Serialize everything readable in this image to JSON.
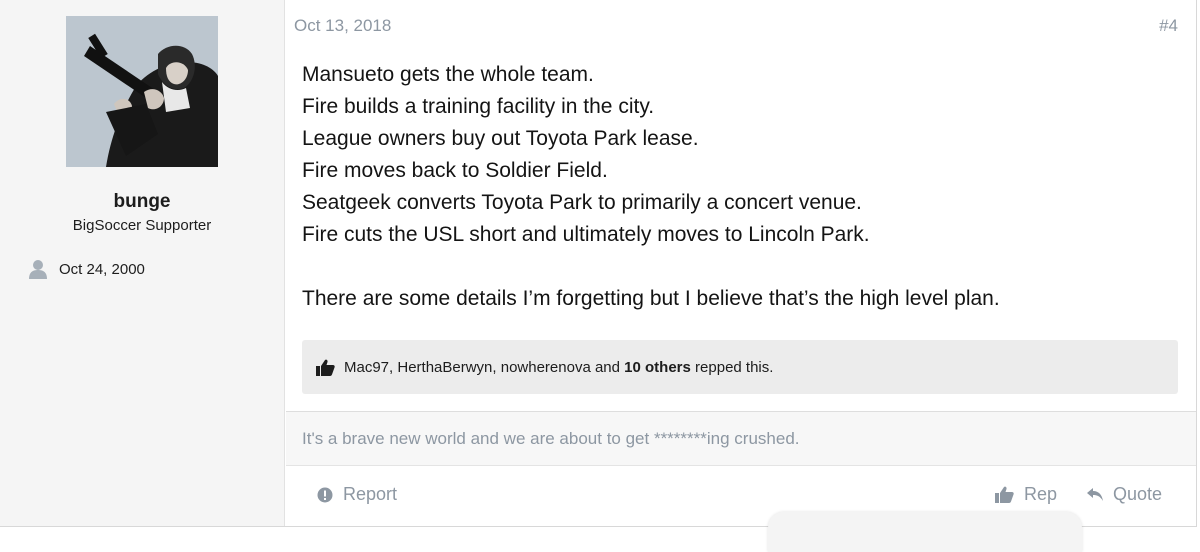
{
  "author": {
    "username": "bunge",
    "title": "BigSoccer Supporter",
    "joined": "Oct 24, 2000"
  },
  "post": {
    "date": "Oct 13, 2018",
    "number": "#4",
    "lines": [
      "Mansueto gets the whole team.",
      "Fire builds a training facility in the city.",
      "League owners buy out Toyota Park lease.",
      "Fire moves back to Soldier Field.",
      "Seatgeek converts Toyota Park to primarily a concert venue.",
      "Fire cuts the USL short and ultimately moves to Lincoln Park.",
      "",
      "There are some details I’m forgetting but I believe that’s the high level plan."
    ]
  },
  "reps": {
    "names": "Mac97, HerthaBerwyn, nowherenova",
    "and": " and ",
    "others": "10 others",
    "suffix": " repped this."
  },
  "signature": "It's a brave new world and we are about to get ********ing crushed.",
  "actions": {
    "report": "Report",
    "rep": "Rep",
    "quote": "Quote"
  },
  "icons": {
    "report": "alert-circle-icon",
    "rep": "thumbs-up-icon",
    "quote": "reply-arrow-icon",
    "joined": "person-icon"
  }
}
